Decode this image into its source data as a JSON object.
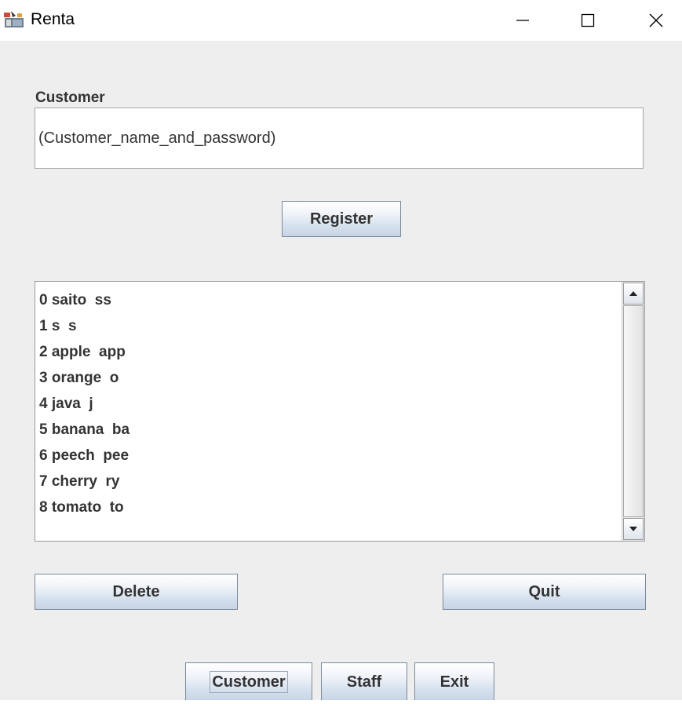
{
  "window": {
    "title": "Renta",
    "controls": {
      "minimize": "minimize-icon",
      "maximize": "maximize-icon",
      "close": "close-icon"
    }
  },
  "customer": {
    "label": "Customer",
    "input_value": "(Customer_name_and_password)"
  },
  "actions": {
    "register_label": "Register",
    "delete_label": "Delete",
    "quit_label": "Quit"
  },
  "list": {
    "items": [
      "0 saito  ss",
      "1 s  s",
      "2 apple  app",
      "3 orange  o",
      "4 java  j",
      "5 banana  ba",
      "6 peech  pee",
      "7 cherry  ry",
      "8 tomato  to"
    ]
  },
  "nav": {
    "customer_label": "Customer",
    "staff_label": "Staff",
    "exit_label": "Exit"
  },
  "colors": {
    "background": "#eeeeee",
    "text": "#333333",
    "button_top": "#ffffff",
    "button_bottom": "#c7d4e5",
    "border": "#9a9a9a"
  }
}
